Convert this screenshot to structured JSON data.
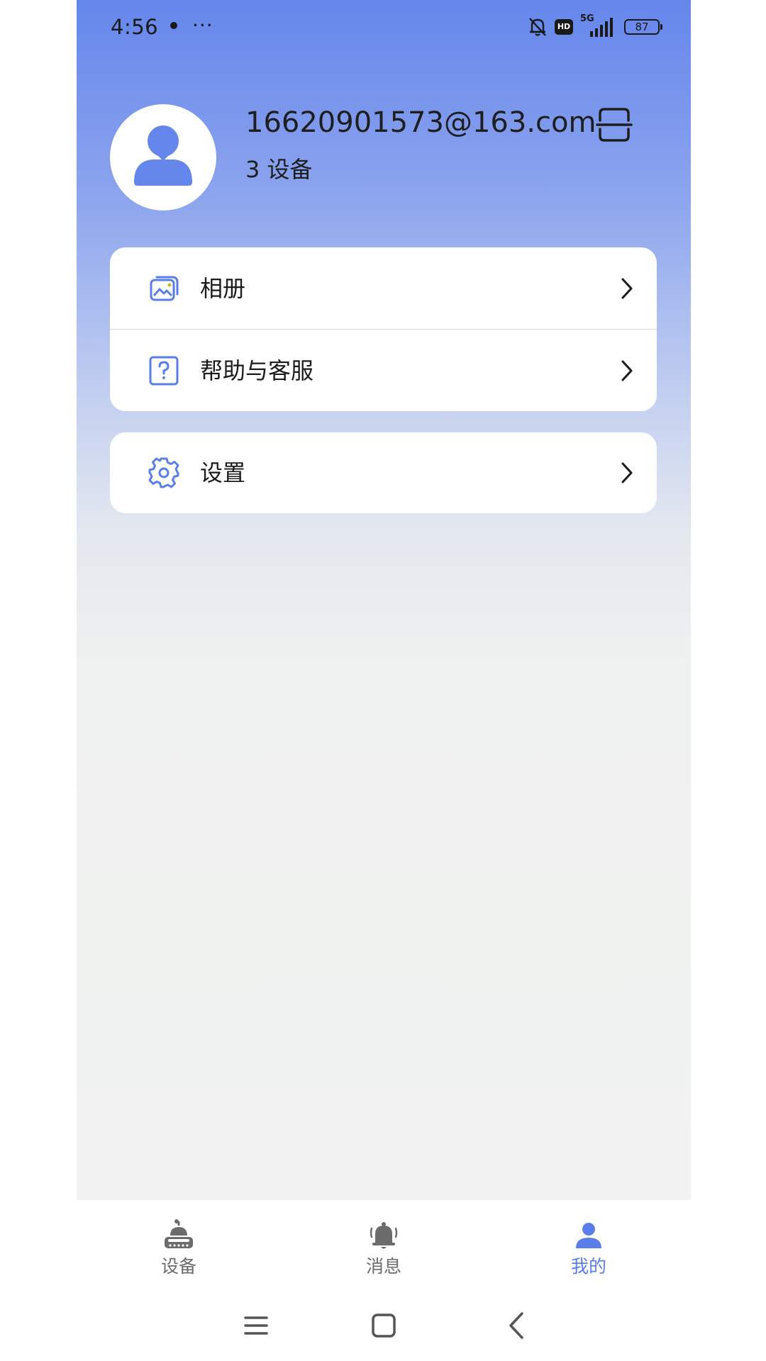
{
  "status_bar": {
    "time": "4:56",
    "more": "···",
    "hd": "HD",
    "network": "5G",
    "battery": "87"
  },
  "profile": {
    "email": "16620901573@163.com",
    "device_count": "3 设备"
  },
  "menu": {
    "items": [
      {
        "label": "相册",
        "icon": "photo-album-icon"
      },
      {
        "label": "帮助与客服",
        "icon": "help-icon"
      }
    ],
    "settings": {
      "label": "设置",
      "icon": "gear-icon"
    }
  },
  "tabs": [
    {
      "label": "设备",
      "icon": "robot-icon",
      "active": false
    },
    {
      "label": "消息",
      "icon": "bell-icon",
      "active": false
    },
    {
      "label": "我的",
      "icon": "person-icon",
      "active": true
    }
  ],
  "colors": {
    "accent": "#5a7ee8",
    "gradient_top": "#6586eb",
    "page_bg": "#f1f2f1"
  }
}
